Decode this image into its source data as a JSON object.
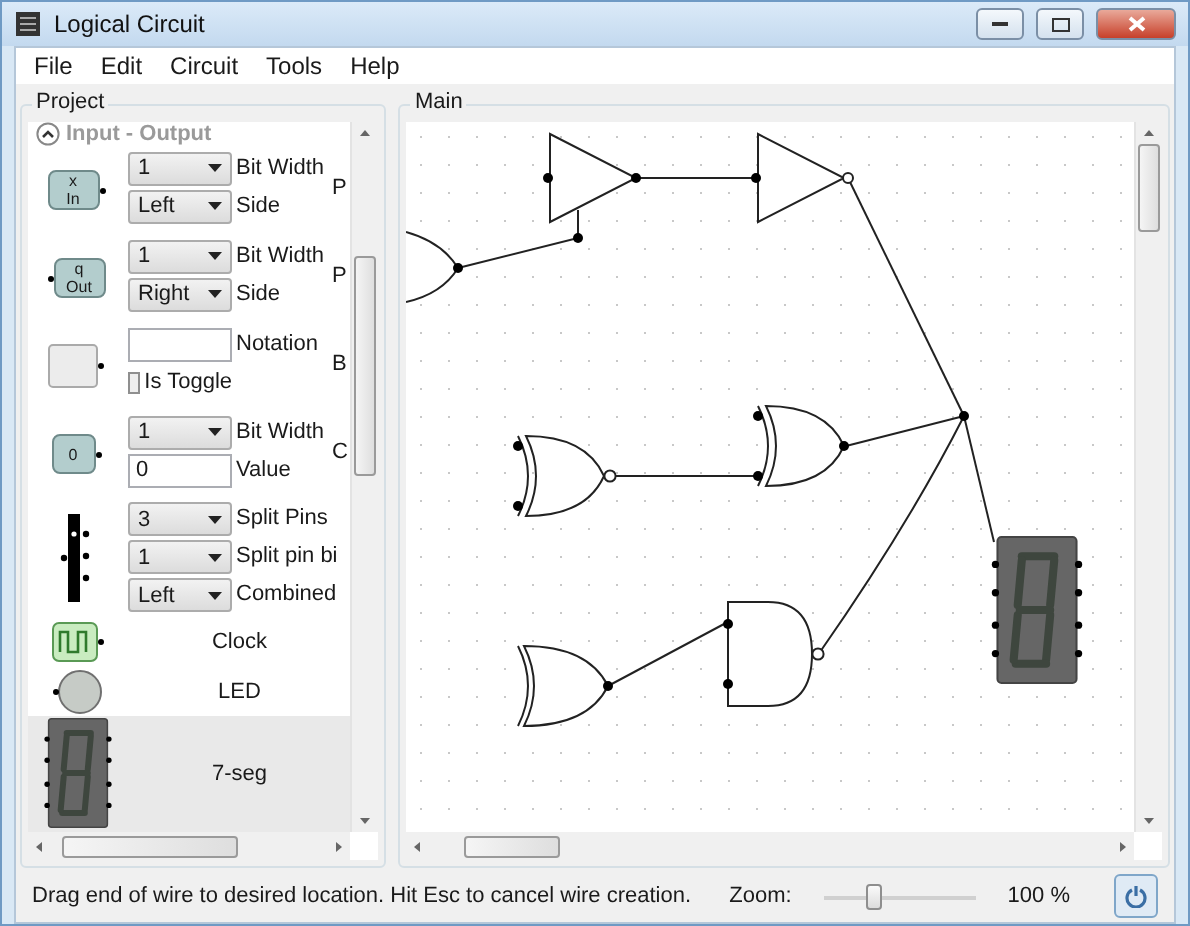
{
  "window": {
    "title": "Logical Circuit"
  },
  "menu": [
    {
      "label": "File"
    },
    {
      "label": "Edit"
    },
    {
      "label": "Circuit"
    },
    {
      "label": "Tools"
    },
    {
      "label": "Help"
    }
  ],
  "project": {
    "title": "Project",
    "category": {
      "label": "Input - Output",
      "expanded": true
    },
    "items": [
      {
        "kind": "input",
        "selected": false,
        "icon_text": [
          "x",
          "In"
        ],
        "fields": [
          {
            "kind": "dropdown",
            "value": "1",
            "label": "Bit Width"
          },
          {
            "kind": "dropdown",
            "value": "Left",
            "label": "Side"
          }
        ],
        "column_3": "P"
      },
      {
        "kind": "output",
        "selected": false,
        "icon_text": [
          "q",
          "Out"
        ],
        "fields": [
          {
            "kind": "dropdown",
            "value": "1",
            "label": "Bit Width"
          },
          {
            "kind": "dropdown",
            "value": "Right",
            "label": "Side"
          }
        ],
        "column_3": "P"
      },
      {
        "kind": "button",
        "selected": false,
        "fields": [
          {
            "kind": "textbox",
            "label": "Notation"
          },
          {
            "kind": "checkbox",
            "label": "Is Toggle",
            "checked": false
          }
        ],
        "column_3": "B"
      },
      {
        "kind": "constant",
        "selected": false,
        "icon_text": [
          "0"
        ],
        "fields": [
          {
            "kind": "dropdown",
            "value": "1",
            "label": "Bit Width"
          },
          {
            "kind": "textbox",
            "value": "0",
            "label": "Value"
          }
        ],
        "column_3": "C"
      },
      {
        "kind": "splitter",
        "selected": false,
        "fields": [
          {
            "kind": "dropdown",
            "value": "3",
            "label": "Split Pins"
          },
          {
            "kind": "dropdown",
            "value": "1",
            "label": "Split pin bi"
          },
          {
            "kind": "dropdown",
            "value": "Left",
            "label": "Combined"
          }
        ]
      },
      {
        "kind": "clock",
        "selected": false,
        "label": "Clock"
      },
      {
        "kind": "led",
        "selected": false,
        "label": "LED"
      },
      {
        "kind": "seven_segment",
        "selected": true,
        "label": "7-seg"
      }
    ]
  },
  "main": {
    "title": "Main"
  },
  "status_bar": {
    "message": "Drag end of wire to desired location. Hit Esc to cancel wire creation.",
    "zoom_label": "Zoom:",
    "zoom": {
      "level": 0.33
    },
    "zoom_value": "100 %"
  }
}
